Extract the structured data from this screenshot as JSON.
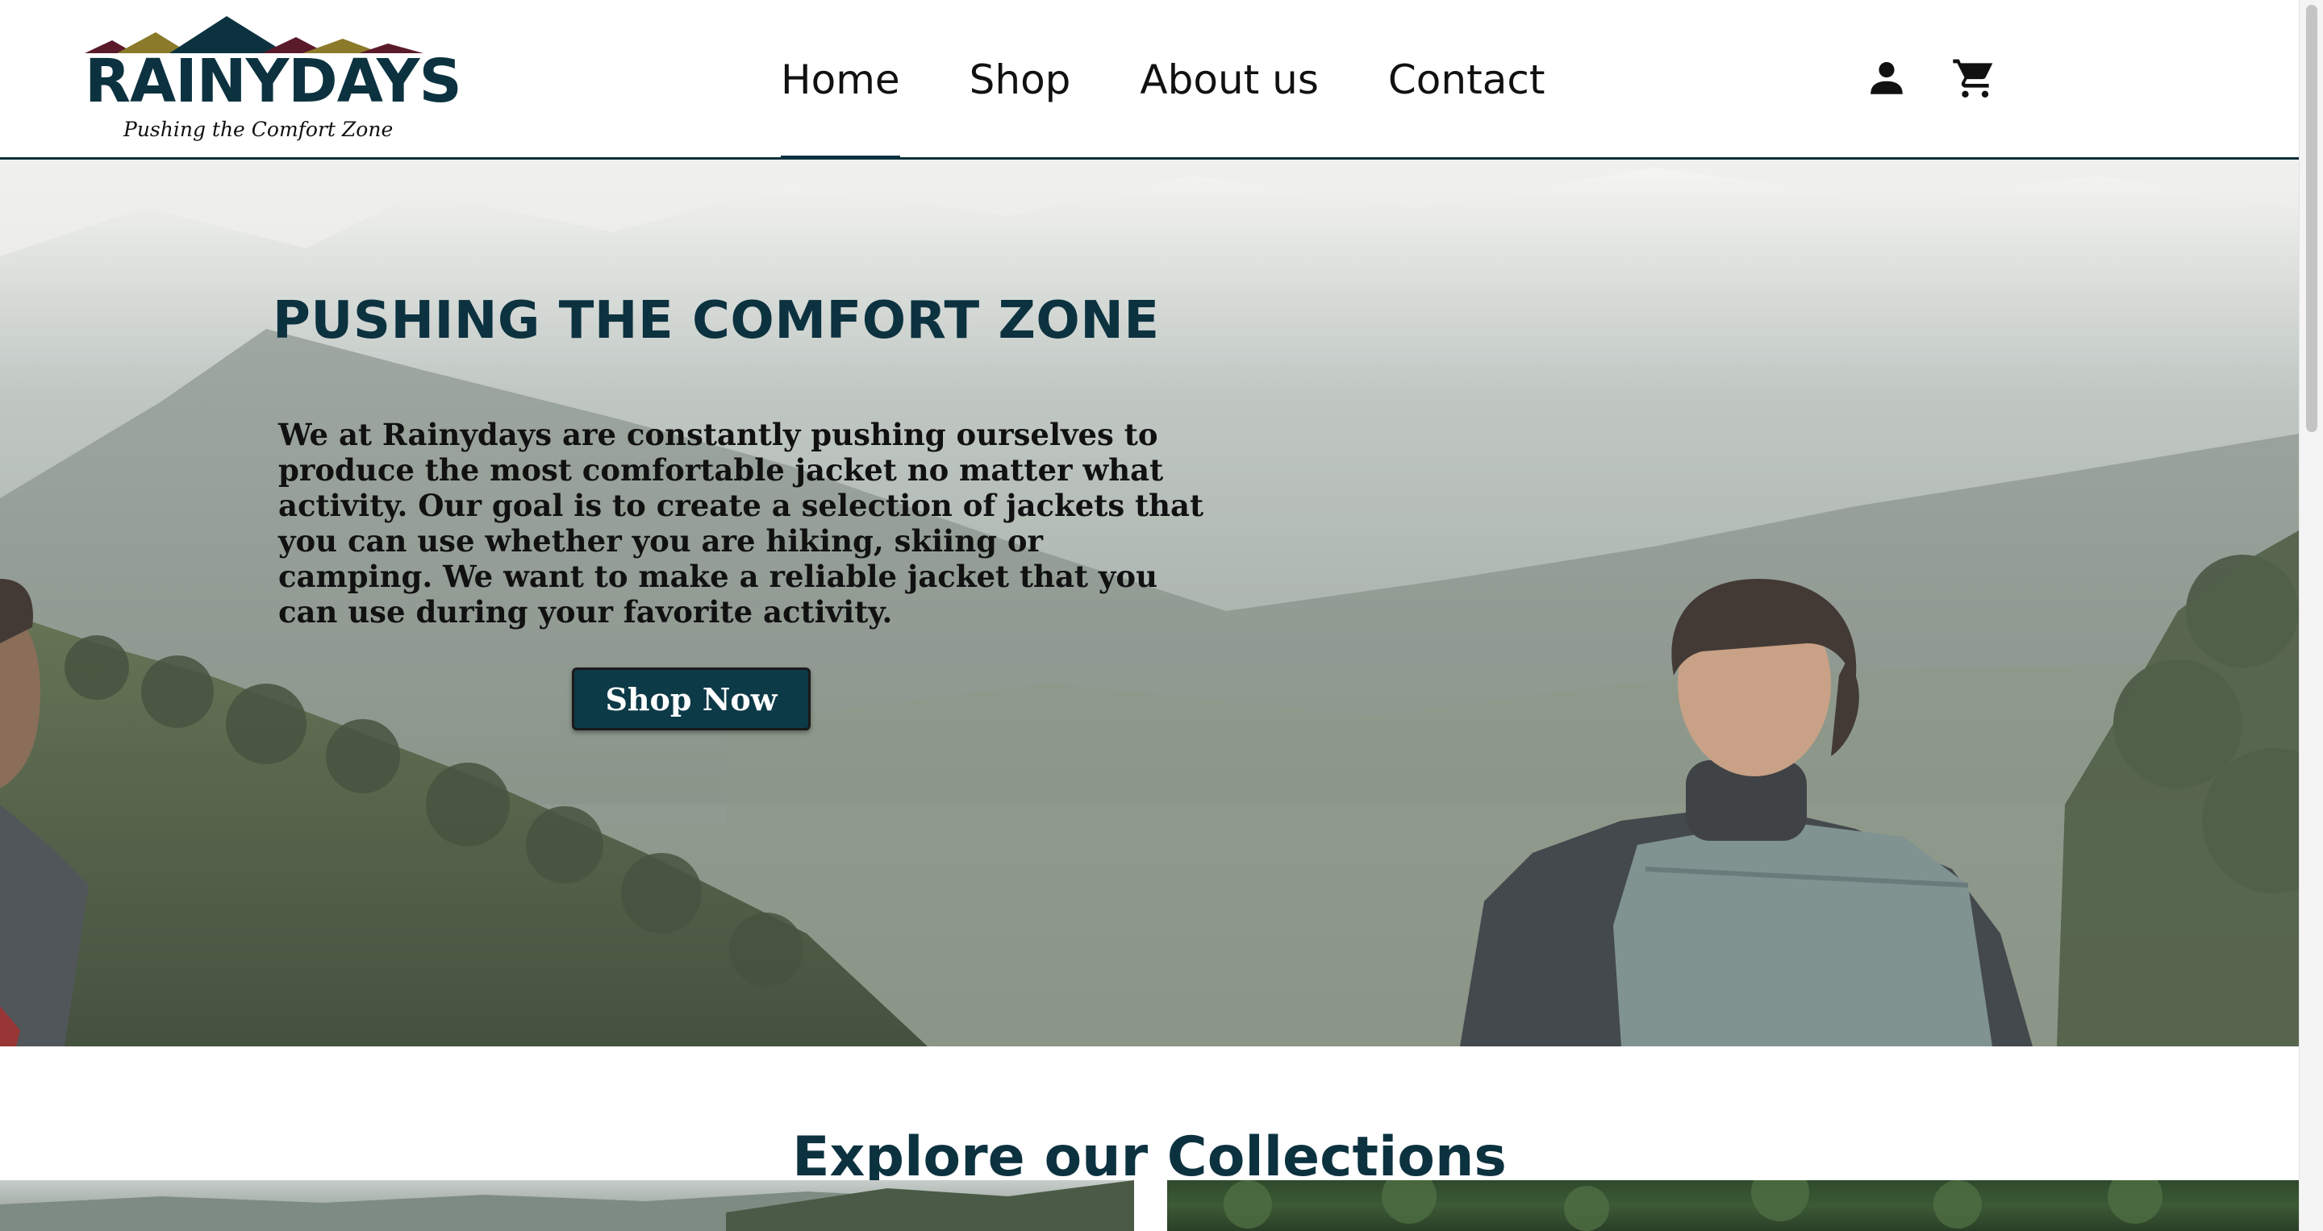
{
  "header": {
    "logo_name": "RAINYDAYS",
    "logo_tagline": "Pushing the Comfort Zone",
    "nav": [
      {
        "label": "Home",
        "active": true
      },
      {
        "label": "Shop",
        "active": false
      },
      {
        "label": "About us",
        "active": false
      },
      {
        "label": "Contact",
        "active": false
      }
    ],
    "icons": {
      "account": "user-icon",
      "cart": "cart-icon"
    }
  },
  "hero": {
    "title": "PUSHING THE COMFORT ZONE",
    "text": "We at Rainydays are constantly pushing ourselves to produce the most comfortable jacket no matter what activity. Our goal is to create a selection of jackets that you can use whether you are hiking, skiing or camping. We want to make a reliable jacket that you can use during your favorite activity.",
    "cta_label": "Shop Now"
  },
  "collections": {
    "title": "Explore our Collections"
  },
  "colors": {
    "brand": "#0c3240",
    "button": "#0c3a47",
    "logo_mountain_dark": "#5a1a2a",
    "logo_mountain_gold": "#8a7a2a",
    "logo_mountain_teal": "#0c3240"
  }
}
